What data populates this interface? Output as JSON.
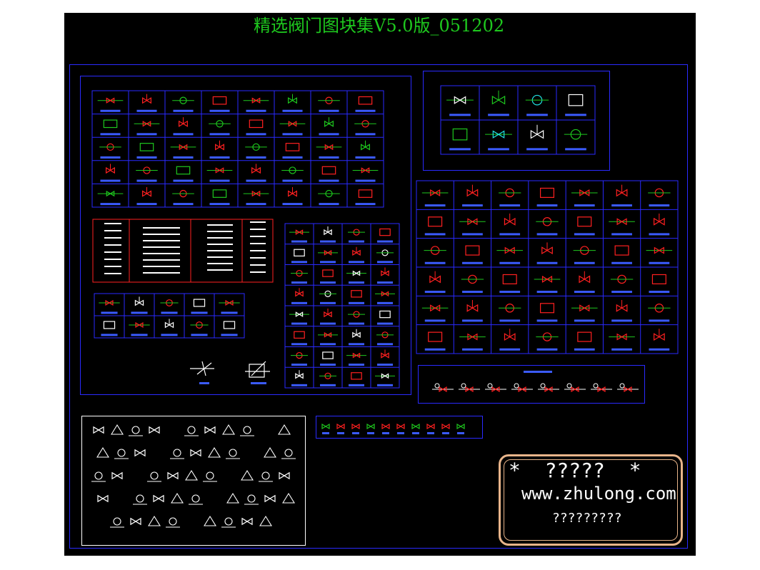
{
  "title": "精选阀门图块集V5.0版_051202",
  "watermark": {
    "line1": "*  ?????  *",
    "line2": "www.zhulong.com",
    "line3": "?????????"
  },
  "colors": {
    "background": "#000000",
    "frame": "#2a2aff",
    "title": "#1ec81e",
    "watermark_border": "#e8b48a",
    "symbol_red": "#ff2020",
    "symbol_green": "#1ec81e",
    "symbol_cyan": "#20e0e0",
    "symbol_white": "#ffffff",
    "label_blue": "#3b5bff"
  },
  "symbol_groups": [
    {
      "name": "valve-table-top-left",
      "rows": 5,
      "cols": 8
    },
    {
      "name": "valve-table-top-right",
      "rows": 2,
      "cols": 4
    },
    {
      "name": "valve-table-right",
      "rows": 6,
      "cols": 7
    },
    {
      "name": "valve-table-center",
      "rows": 8,
      "cols": 4
    },
    {
      "name": "valve-spec-list",
      "rows": 1,
      "cols": 4
    },
    {
      "name": "valve-strip-small",
      "rows": 2,
      "cols": 5
    },
    {
      "name": "valve-strip-bottom",
      "rows": 1,
      "cols": 10
    },
    {
      "name": "valve-assembly-row",
      "rows": 1,
      "cols": 8
    },
    {
      "name": "white-symbol-legend",
      "rows": 5,
      "cols": 11
    }
  ]
}
